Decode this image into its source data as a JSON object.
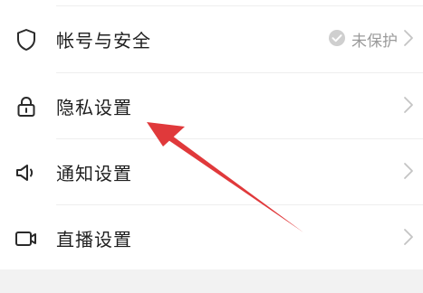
{
  "settings": {
    "items": [
      {
        "label": "帐号与安全",
        "status": "未保护",
        "icon": "shield-icon"
      },
      {
        "label": "隐私设置",
        "icon": "lock-icon"
      },
      {
        "label": "通知设置",
        "icon": "speaker-icon"
      },
      {
        "label": "直播设置",
        "icon": "video-camera-icon"
      }
    ]
  },
  "colors": {
    "text": "#1f1f1f",
    "muted": "#9a9a9a",
    "chevron": "#c4c4c4",
    "annotation_arrow": "#e0393b"
  }
}
